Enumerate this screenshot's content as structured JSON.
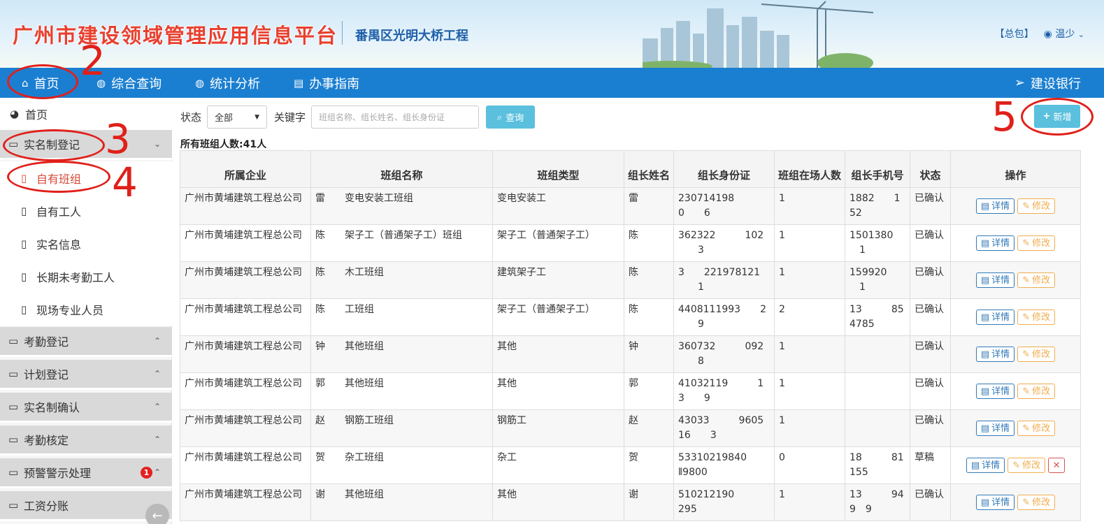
{
  "header": {
    "brand": "广州市建设领域管理应用信息平台",
    "project": "番禺区光明大桥工程",
    "top_link_1": "【总包】",
    "user_name": "温少"
  },
  "nav": {
    "items": [
      {
        "label": "首页",
        "icon": "home-icon"
      },
      {
        "label": "综合查询",
        "icon": "globe-icon"
      },
      {
        "label": "统计分析",
        "icon": "globe-icon"
      },
      {
        "label": "办事指南",
        "icon": "book-icon"
      }
    ],
    "right_label": "建设银行"
  },
  "sidebar": {
    "home": "首页",
    "open_group": "实名制登记",
    "sub_items": [
      "自有班组",
      "自有工人",
      "实名信息",
      "长期未考勤工人",
      "现场专业人员"
    ],
    "groups": [
      "考勤登记",
      "计划登记",
      "实名制确认",
      "考勤核定",
      "预警警示处理",
      "工资分账"
    ],
    "alert_badge": "1"
  },
  "filter": {
    "status_label": "状态",
    "status_value": "全部",
    "keyword_label": "关键字",
    "keyword_placeholder": "班组名称、组长姓名、组长身份证",
    "search_label": "查询",
    "add_label": "新增"
  },
  "summary": "所有班组人数:41人",
  "table": {
    "headers": [
      "所属企业",
      "班组名称",
      "班组类型",
      "组长姓名",
      "组长身份证",
      "班组在场人数",
      "组长手机号",
      "状态",
      "操作"
    ],
    "detail_label": "详情",
    "edit_label": "修改",
    "rows": [
      {
        "company": "广州市黄埔建筑工程总公司",
        "team": "雷  变电安装工班组",
        "type": "变电安装工",
        "leader": "雷",
        "id_card": "230714198   0  6",
        "count": "1",
        "phone": "1882  152",
        "status": "已确认",
        "deletable": false
      },
      {
        "company": "广州市黄埔建筑工程总公司",
        "team": "陈  架子工（普通架子工）班组",
        "type": "架子工（普通架子工）",
        "leader": "陈",
        "id_card": "362322   102  3",
        "count": "1",
        "phone": "1501380  1",
        "status": "已确认",
        "deletable": false
      },
      {
        "company": "广州市黄埔建筑工程总公司",
        "team": "陈  木工班组",
        "type": "建筑架子工",
        "leader": "陈",
        "id_card": "3  221978121  1",
        "count": "1",
        "phone": "159920  1",
        "status": "已确认",
        "deletable": false
      },
      {
        "company": "广州市黄埔建筑工程总公司",
        "team": "陈  工班组",
        "type": "架子工（普通架子工）",
        "leader": "陈",
        "id_card": "4408111993  2  9",
        "count": "2",
        "phone": "13   854785",
        "status": "已确认",
        "deletable": false
      },
      {
        "company": "广州市黄埔建筑工程总公司",
        "team": "钟  其他班组",
        "type": "其他",
        "leader": "钟",
        "id_card": "360732   092  8",
        "count": "1",
        "phone": "",
        "status": "已确认",
        "deletable": false
      },
      {
        "company": "广州市黄埔建筑工程总公司",
        "team": "郭  其他班组",
        "type": "其他",
        "leader": "郭",
        "id_card": "41032119   13  9",
        "count": "1",
        "phone": "",
        "status": "已确认",
        "deletable": false
      },
      {
        "company": "广州市黄埔建筑工程总公司",
        "team": "赵  钢筋工班组",
        "type": "钢筋工",
        "leader": "赵",
        "id_card": "43033   960516  3",
        "count": "1",
        "phone": "",
        "status": "已确认",
        "deletable": false
      },
      {
        "company": "广州市黄埔建筑工程总公司",
        "team": "贺  杂工班组",
        "type": "杂工",
        "leader": "贺",
        "id_card": "53310219840  ⦀9800",
        "count": "0",
        "phone": "18   81155",
        "status": "草稿",
        "deletable": true
      },
      {
        "company": "广州市黄埔建筑工程总公司",
        "team": "谢  其他班组",
        "type": "其他",
        "leader": "谢",
        "id_card": "510212190   295",
        "count": "1",
        "phone": "13   949 9",
        "status": "已确认",
        "deletable": false
      }
    ]
  },
  "annotations": [
    "2",
    "3",
    "4",
    "5"
  ],
  "colors": {
    "nav_blue": "#1b7fd1",
    "brand_red": "#e8402f",
    "accent_cyan": "#5bc0de",
    "annotation_red": "#e0201a"
  }
}
